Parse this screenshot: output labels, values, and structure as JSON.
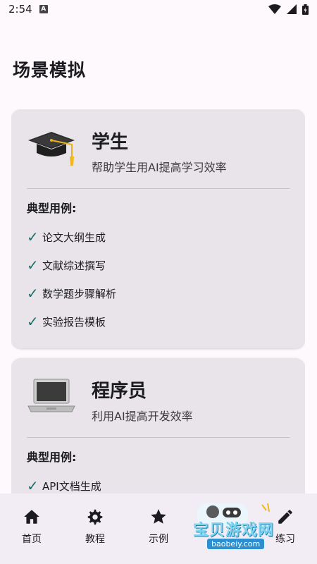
{
  "status": {
    "time": "2:54",
    "sim_label": "A"
  },
  "page": {
    "title": "场景模拟"
  },
  "cards": [
    {
      "title": "学生",
      "subtitle": "帮助学生用AI提高学习效率",
      "icon": "graduation-cap-icon",
      "examples_label": "典型用例:",
      "examples": [
        "论文大纲生成",
        "文献综述撰写",
        "数学题步骤解析",
        "实验报告模板"
      ]
    },
    {
      "title": "程序员",
      "subtitle": "利用AI提高开发效率",
      "icon": "laptop-icon",
      "examples_label": "典型用例:",
      "examples": [
        "API文档生成"
      ]
    }
  ],
  "nav": [
    {
      "label": "首页",
      "icon": "home-icon"
    },
    {
      "label": "教程",
      "icon": "gear-icon"
    },
    {
      "label": "示例",
      "icon": "star-icon"
    },
    {
      "label": "",
      "icon": ""
    },
    {
      "label": "练习",
      "icon": "pencil-icon"
    }
  ],
  "watermark": {
    "text": "宝贝游戏网",
    "url": "baobeiy.com"
  },
  "colors": {
    "card_bg": "#e9e4ea",
    "check": "#1b6f6a",
    "nav_bg": "#f2ecf4"
  }
}
